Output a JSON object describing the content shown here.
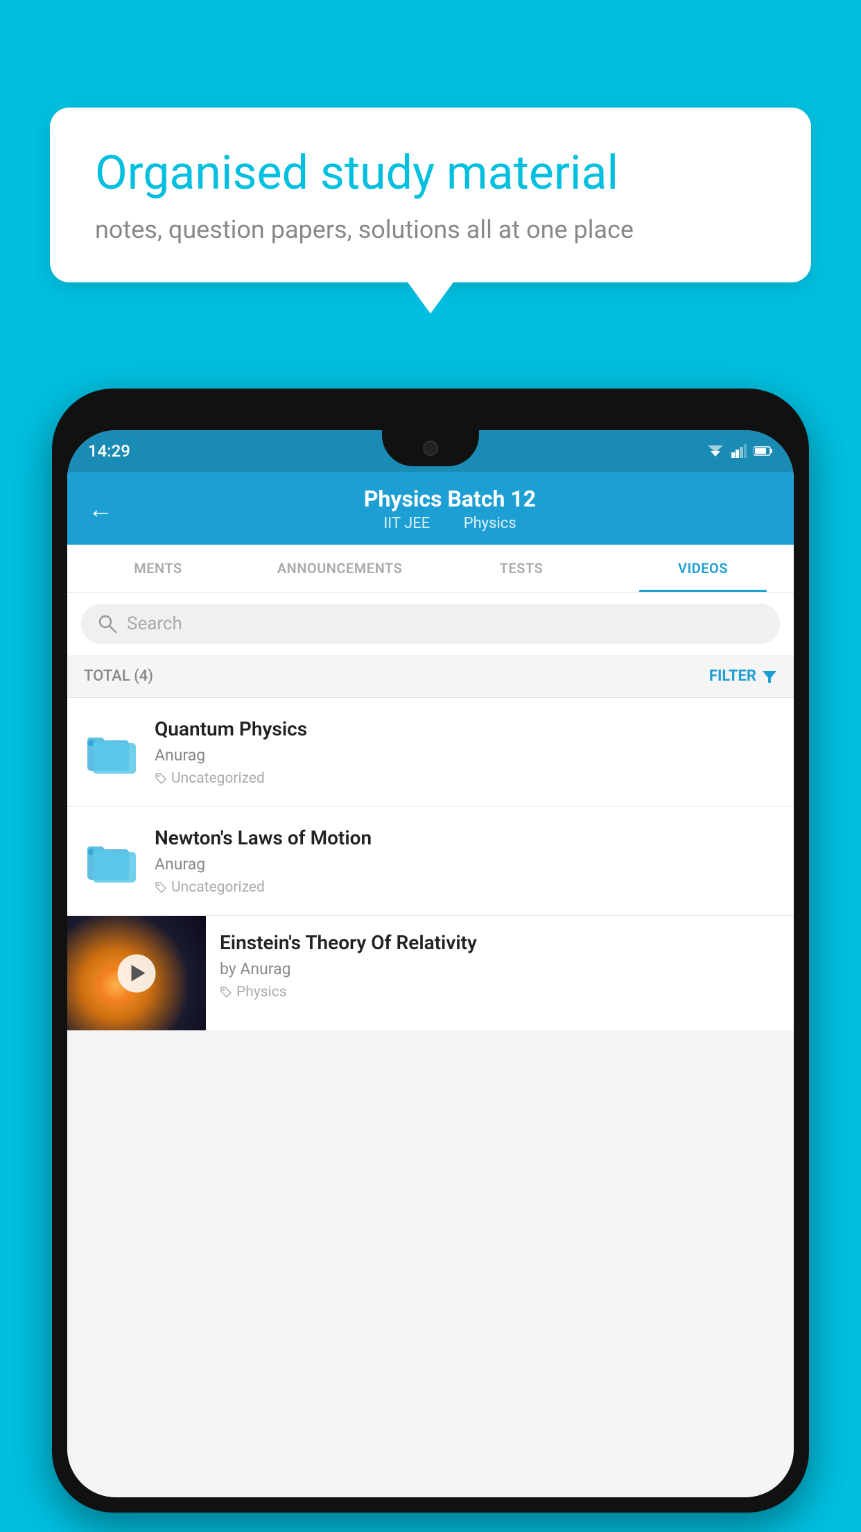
{
  "background_color": "#00BFDF",
  "speech_bubble": {
    "title": "Organised study material",
    "subtitle": "notes, question papers, solutions all at one place"
  },
  "status_bar": {
    "time": "14:29"
  },
  "header": {
    "title": "Physics Batch 12",
    "subtitle_part1": "IIT JEE",
    "subtitle_part2": "Physics",
    "back_label": "←"
  },
  "tabs": [
    {
      "label": "MENTS",
      "active": false
    },
    {
      "label": "ANNOUNCEMENTS",
      "active": false
    },
    {
      "label": "TESTS",
      "active": false
    },
    {
      "label": "VIDEOS",
      "active": true
    }
  ],
  "search": {
    "placeholder": "Search"
  },
  "filter_bar": {
    "total_label": "TOTAL (4)",
    "filter_label": "FILTER"
  },
  "videos": [
    {
      "title": "Quantum Physics",
      "author": "Anurag",
      "tag": "Uncategorized",
      "type": "folder"
    },
    {
      "title": "Newton's Laws of Motion",
      "author": "Anurag",
      "tag": "Uncategorized",
      "type": "folder"
    },
    {
      "title": "Einstein's Theory Of Relativity",
      "author": "by Anurag",
      "tag": "Physics",
      "type": "thumbnail"
    }
  ]
}
